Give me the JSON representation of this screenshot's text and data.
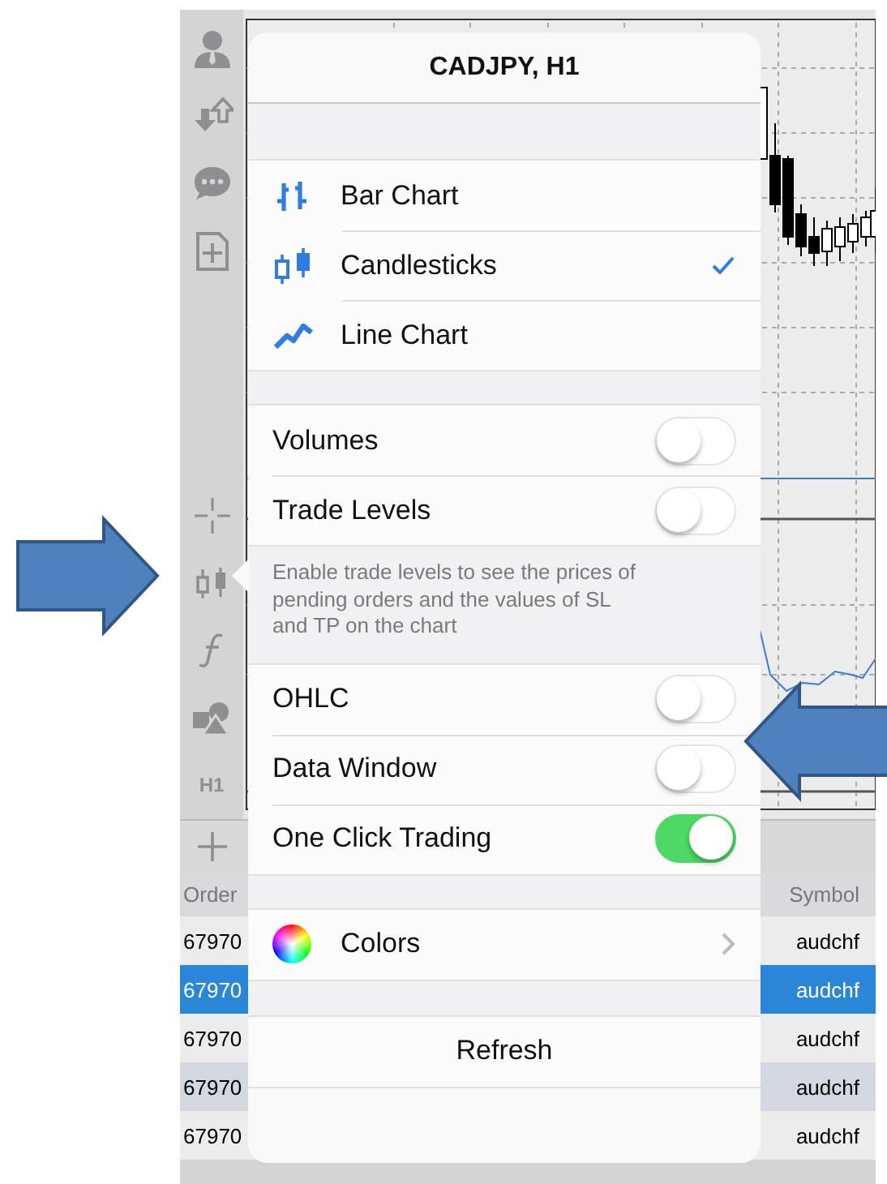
{
  "sidebar": {
    "timeframe": "H1"
  },
  "popover": {
    "title": "CADJPY, H1",
    "groups": [
      {
        "items": [
          {
            "kind": "chart-type",
            "label": "Bar Chart",
            "selected": false
          },
          {
            "kind": "chart-type",
            "label": "Candlesticks",
            "selected": true
          },
          {
            "kind": "chart-type",
            "label": "Line Chart",
            "selected": false
          }
        ]
      },
      {
        "items": [
          {
            "kind": "toggle",
            "label": "Volumes",
            "on": false
          },
          {
            "kind": "toggle",
            "label": "Trade Levels",
            "on": false
          },
          {
            "kind": "note",
            "text": "Enable trade levels to see the prices of pending orders and the values of SL and TP on the chart"
          }
        ]
      },
      {
        "items": [
          {
            "kind": "toggle",
            "label": "OHLC",
            "on": false
          },
          {
            "kind": "toggle",
            "label": "Data Window",
            "on": false
          },
          {
            "kind": "toggle",
            "label": "One Click Trading",
            "on": true
          }
        ]
      },
      {
        "items": [
          {
            "kind": "link",
            "label": "Colors"
          }
        ]
      },
      {
        "items": [
          {
            "kind": "action",
            "label": "Refresh"
          }
        ]
      }
    ]
  },
  "orders_table": {
    "columns": [
      {
        "label": "Order"
      },
      {
        "label": "Symbol"
      }
    ],
    "rows": [
      {
        "order": "67970",
        "symbol": "audchf",
        "selected": false
      },
      {
        "order": "67970",
        "symbol": "audchf",
        "selected": true
      },
      {
        "order": "67970",
        "symbol": "audchf",
        "selected": false
      },
      {
        "order": "67970",
        "symbol": "audchf",
        "selected": false
      },
      {
        "order": "67970",
        "symbol": "audchf",
        "selected": false
      }
    ]
  },
  "annotations": [
    {
      "kind": "arrow-right"
    },
    {
      "kind": "arrow-left"
    }
  ]
}
